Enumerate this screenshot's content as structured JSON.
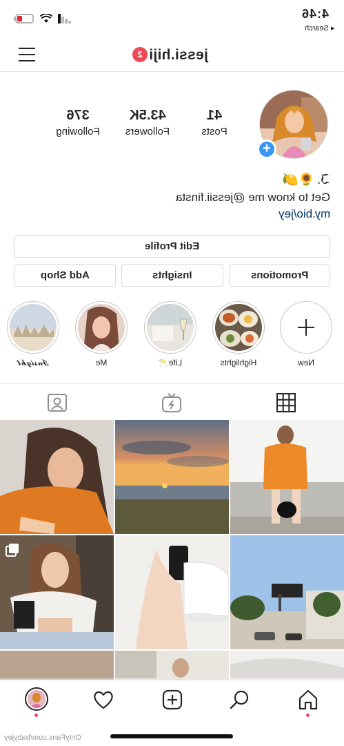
{
  "status_bar": {
    "time": "4:46",
    "back_label": "◂ Search"
  },
  "header": {
    "username": "jessi.hiji",
    "notification_count": "2"
  },
  "profile": {
    "stats": [
      {
        "number": "41",
        "label": "Posts"
      },
      {
        "number": "43.5K",
        "label": "Followers"
      },
      {
        "number": "376",
        "label": "Following"
      }
    ],
    "bio_name": "ℑ.",
    "bio_emoji": "🍋🌻",
    "bio_text": "Get to know me @jessii.finsta",
    "bio_link": "my.bio/jey"
  },
  "buttons": {
    "edit_profile": "Edit Profile",
    "promotions": "Promotions",
    "insights": "Insights",
    "add_shop": "Add Shop"
  },
  "highlights": [
    {
      "label": "New"
    },
    {
      "label": "Highlights"
    },
    {
      "label": "Life🥂"
    },
    {
      "label": "Me"
    },
    {
      "label": "𝓘𝓷𝓼𝓲𝓰𝓱𝓽"
    }
  ],
  "tabs": [
    {
      "icon": "grid-icon",
      "label": "Posts grid"
    },
    {
      "icon": "igtv-icon",
      "label": "IGTV"
    },
    {
      "icon": "tagged-icon",
      "label": "Tagged"
    }
  ],
  "bottom_nav": [
    {
      "icon": "home-icon"
    },
    {
      "icon": "search-icon"
    },
    {
      "icon": "add-post-icon"
    },
    {
      "icon": "activity-heart-icon"
    },
    {
      "icon": "profile-avatar-icon"
    }
  ],
  "watermark": "OnlyFans.com/babyjey",
  "colors": {
    "accent_blue": "#3897f0",
    "badge_red": "#ed4956",
    "link": "#003569",
    "divider": "#e6e6e6"
  }
}
